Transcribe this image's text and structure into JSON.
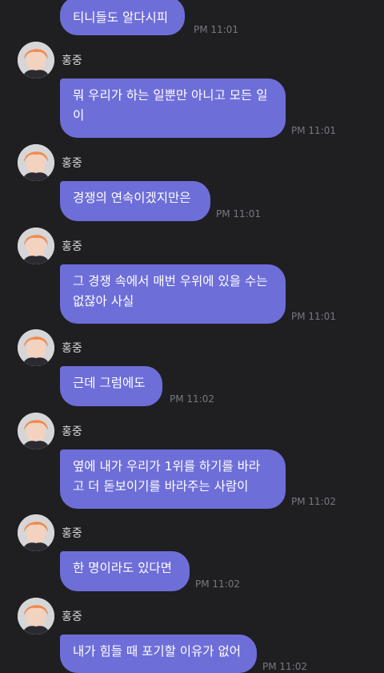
{
  "messages": [
    {
      "lines": [
        "티니들도 알다시피"
      ],
      "time": "PM 11:01"
    },
    {
      "sender": "홍중",
      "lines": [
        "뭐 우리가 하는 일뿐만 아니고 모든 일",
        "이"
      ],
      "time": "PM 11:01"
    },
    {
      "sender": "홍중",
      "lines": [
        "경쟁의 연속이겠지만은"
      ],
      "time": "PM 11:01"
    },
    {
      "sender": "홍중",
      "lines": [
        "그 경쟁 속에서 매번 우위에 있을 수는",
        "없잖아 사실"
      ],
      "time": "PM 11:01"
    },
    {
      "sender": "홍중",
      "lines": [
        "근데 그럼에도"
      ],
      "time": "PM 11:02"
    },
    {
      "sender": "홍중",
      "lines": [
        "옆에 내가 우리가 1위를 하기를 바라",
        "고 더 돋보이기를 바라주는 사람이"
      ],
      "time": "PM 11:02"
    },
    {
      "sender": "홍중",
      "lines": [
        "한 명이라도 있다면"
      ],
      "time": "PM 11:02"
    },
    {
      "sender": "홍중",
      "lines": [
        "내가 힘들 때 포기할 이유가 없어"
      ],
      "time": "PM 11:02"
    }
  ],
  "colors": {
    "background": "#1f1f22",
    "bubble": "#6e6ed9",
    "bubble_text": "#ffffff",
    "name_text": "#d9d9de",
    "time_text": "#777780",
    "avatar_hair": "#f08a4b"
  },
  "icons": {
    "avatar": "profile-photo-orange-hair"
  }
}
